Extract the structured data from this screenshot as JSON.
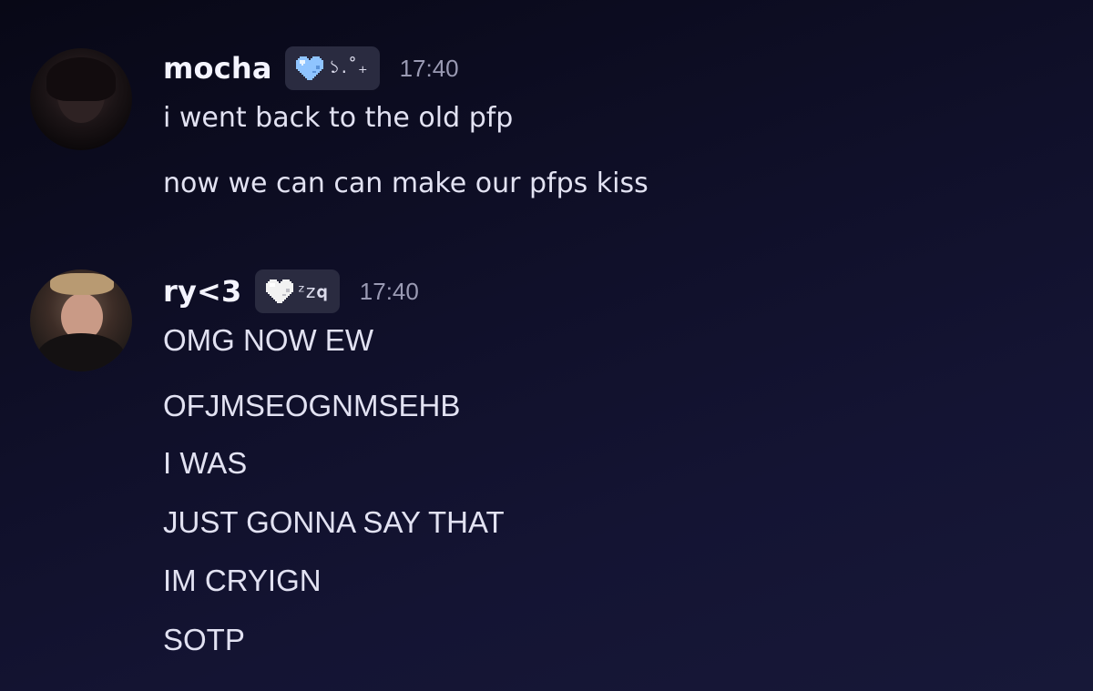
{
  "messages": [
    {
      "username": "mocha",
      "tag_text": "১.˚₊",
      "tag_icon": "blue-pixel-heart-icon",
      "tag_color": "#8fc4ff",
      "timestamp": "17:40",
      "lines": [
        "i went back to the old pfp",
        "now we can can make our pfps kiss"
      ]
    },
    {
      "username": "ry<3",
      "tag_text": "ᶻ𝗓𝐪",
      "tag_icon": "white-pixel-heart-icon",
      "tag_color": "#f2f2f2",
      "timestamp": "17:40",
      "lines": [
        "OMG NOW EW",
        "OFJMSEOGNMSEHB",
        "I WAS",
        "JUST GONNA SAY THAT",
        "IM CRYIGN",
        "SOTP"
      ]
    }
  ]
}
